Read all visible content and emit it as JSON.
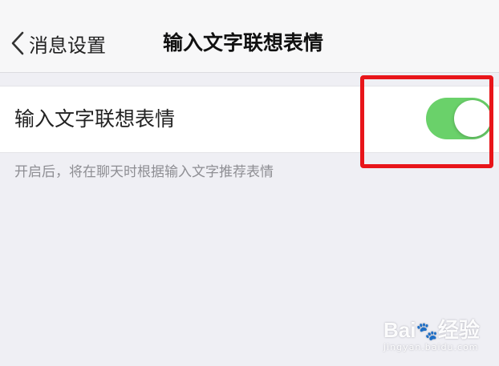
{
  "nav": {
    "back_label": "消息设置",
    "title": "输入文字联想表情"
  },
  "setting": {
    "label": "输入文字联想表情",
    "enabled": true,
    "hint": "开启后，将在聊天时根据输入文字推荐表情"
  },
  "colors": {
    "background": "#efeff4",
    "toggle_on": "#6ad16a",
    "highlight": "#e8151a"
  },
  "watermark": {
    "logo": "Bai🐾经验",
    "site": "jingyan.baidu.com"
  }
}
